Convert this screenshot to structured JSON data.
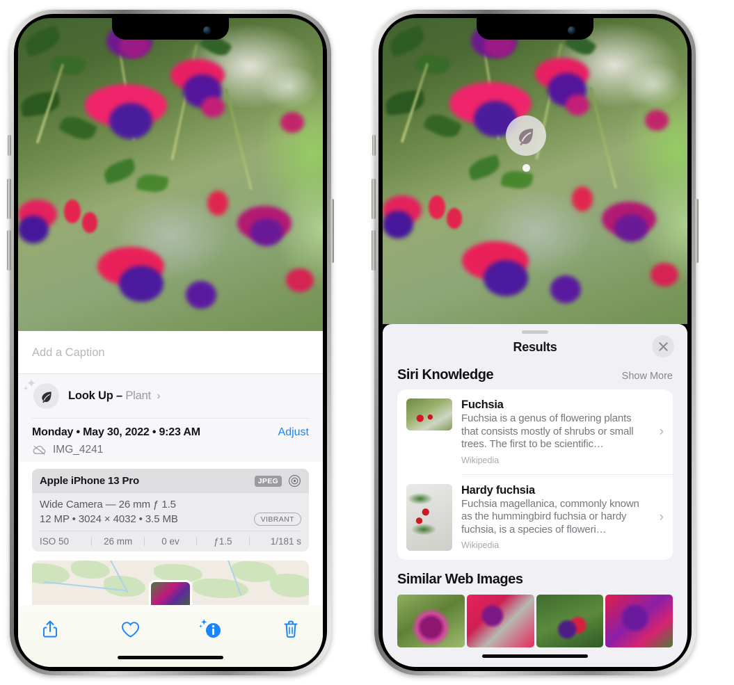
{
  "left_phone": {
    "caption_field": {
      "placeholder": "Add a Caption",
      "value": ""
    },
    "lookup": {
      "label": "Look Up –",
      "subject": "Plant",
      "chevron": "›",
      "icon": "leaf-icon"
    },
    "info": {
      "date": "Monday • May 30, 2022 • 9:23 AM",
      "adjust_label": "Adjust",
      "filename": "IMG_4241",
      "cloud_icon": "icloud-slash-icon"
    },
    "exif": {
      "device": "Apple iPhone 13 Pro",
      "format_tag": "JPEG",
      "aperture_icon": "aperture-icon",
      "lens_line": "Wide Camera — 26 mm ƒ 1.5",
      "size_line": "12 MP • 3024 × 4032 • 3.5 MB",
      "style_tag": "VIBRANT",
      "stats": [
        "ISO 50",
        "26 mm",
        "0 ev",
        "ƒ1.5",
        "1/181 s"
      ]
    },
    "toolbar": [
      {
        "name": "share-button",
        "icon": "share-icon"
      },
      {
        "name": "favorite-button",
        "icon": "heart-icon"
      },
      {
        "name": "info-button",
        "icon": "info-sparkle-icon"
      },
      {
        "name": "delete-button",
        "icon": "trash-icon"
      }
    ]
  },
  "right_phone": {
    "marker": {
      "icon": "leaf-icon",
      "label": "plant-lookup-marker"
    },
    "sheet": {
      "title": "Results",
      "close_label": "✕"
    },
    "siri_knowledge": {
      "title": "Siri Knowledge",
      "show_more": "Show More",
      "entries": [
        {
          "title": "Fuchsia",
          "description": "Fuchsia is a genus of flowering plants that consists mostly of shrubs or small trees. The first to be scientific…",
          "source": "Wikipedia",
          "chevron": "›"
        },
        {
          "title": "Hardy fuchsia",
          "description": "Fuchsia magellanica, commonly known as the hummingbird fuchsia or hardy fuchsia, is a species of floweri…",
          "source": "Wikipedia",
          "chevron": "›"
        }
      ]
    },
    "similar_web_images": {
      "title": "Similar Web Images",
      "items": [
        "fuchsia-thumb-1",
        "fuchsia-thumb-2",
        "fuchsia-thumb-3",
        "fuchsia-thumb-4"
      ]
    }
  },
  "colors": {
    "accent_blue": "#1b84fb",
    "sheet_gray": "#f1f1f5",
    "card_white": "#ffffff",
    "secondary_text": "#86868d"
  }
}
